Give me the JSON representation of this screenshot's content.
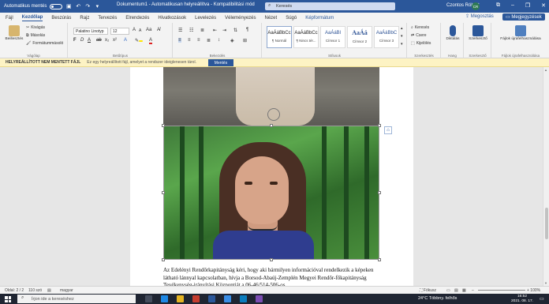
{
  "titlebar": {
    "autosave_label": "Automatikus mentés",
    "window_title": "Dokumentum1 - Automatikusan helyreállítva - Kompatibilitási mód",
    "search_placeholder": "Keresés",
    "user_name": "Czontos Róbert",
    "user_initials": "CR",
    "minimize": "–",
    "restore": "❐",
    "close": "✕"
  },
  "tabs": {
    "items": [
      "Fájl",
      "Kezdőlap",
      "Beszúrás",
      "Rajz",
      "Tervezés",
      "Elrendezés",
      "Hivatkozások",
      "Levelezés",
      "Véleményezés",
      "Nézet",
      "Súgó",
      "Képformátum"
    ],
    "active_index": 1,
    "share": "Megosztás",
    "comments": "Megjegyzések"
  },
  "ribbon": {
    "clipboard": {
      "label": "Vágólap",
      "paste": "Beillesztés",
      "cut": "Kivágás",
      "copy": "Másolás",
      "format_painter": "Formátummásoló"
    },
    "font": {
      "label": "Betűtípus",
      "font_name": "Palatino Linotyp",
      "font_size": "12",
      "grow": "A",
      "shrink": "A",
      "case": "Aa",
      "bold": "F",
      "italic": "D",
      "underline": "A",
      "strike": "ab",
      "subscript": "x₂",
      "superscript": "x²"
    },
    "paragraph": {
      "label": "Bekezdés"
    },
    "styles": {
      "label": "Stílusok",
      "items": [
        {
          "sample": "AaÁáBbCc",
          "name": "¶ Normál"
        },
        {
          "sample": "AaÁáBbCc",
          "name": "¶ Nincs tér..."
        },
        {
          "sample": "AaÁáBl",
          "name": "Címsor 1"
        },
        {
          "sample": "AaÁá",
          "name": "Címsor 2"
        },
        {
          "sample": "AaÁáBbC",
          "name": "Címsor 3"
        }
      ]
    },
    "editing": {
      "label": "Szerkesztés",
      "find": "Keresés",
      "replace": "Csere",
      "select": "Kijelölés"
    },
    "voice": {
      "label": "Hang",
      "dictate": "Diktálás"
    },
    "editor": {
      "label": "Szerkesztő",
      "editor": "Szerkesztő"
    },
    "refresher": {
      "label": "Fájlok újrafelhasználása",
      "button": "Fájlok újrafelhasználása"
    }
  },
  "warning": {
    "title": "HELYREÁLLÍTOTT NEM MENTETT FÁJL",
    "message": "Ez egy helyreállított fájl, amelyet a rendszer ideiglenesen tárol.",
    "save_button": "Mentés"
  },
  "document": {
    "paragraph": "Az Edelényi Rendőrkapitányság kéri, hogy aki bármilyen információval rendelkezik a képeken látható lánnyal kapcsolatban, hívja a Borsod-Abaúj-Zemplén Megyei Rendőr-főkapitányság Tevékenység-irányítási Központját a 06-46/514-506-os"
  },
  "statusbar": {
    "page": "Oldal: 2 / 2",
    "words": "110 szó",
    "language": "magyar",
    "focus": "Fókusz",
    "zoom": "+ 100%"
  },
  "taskbar": {
    "search_placeholder": "Írjon ide a kereséshez",
    "weather": "24°C Többny. felhős",
    "time": "16:52",
    "date": "2021. 08. 17."
  },
  "colors": {
    "brand": "#2b579a",
    "warning_bg": "#fdf3c4",
    "taskbar": "#1f2532"
  }
}
